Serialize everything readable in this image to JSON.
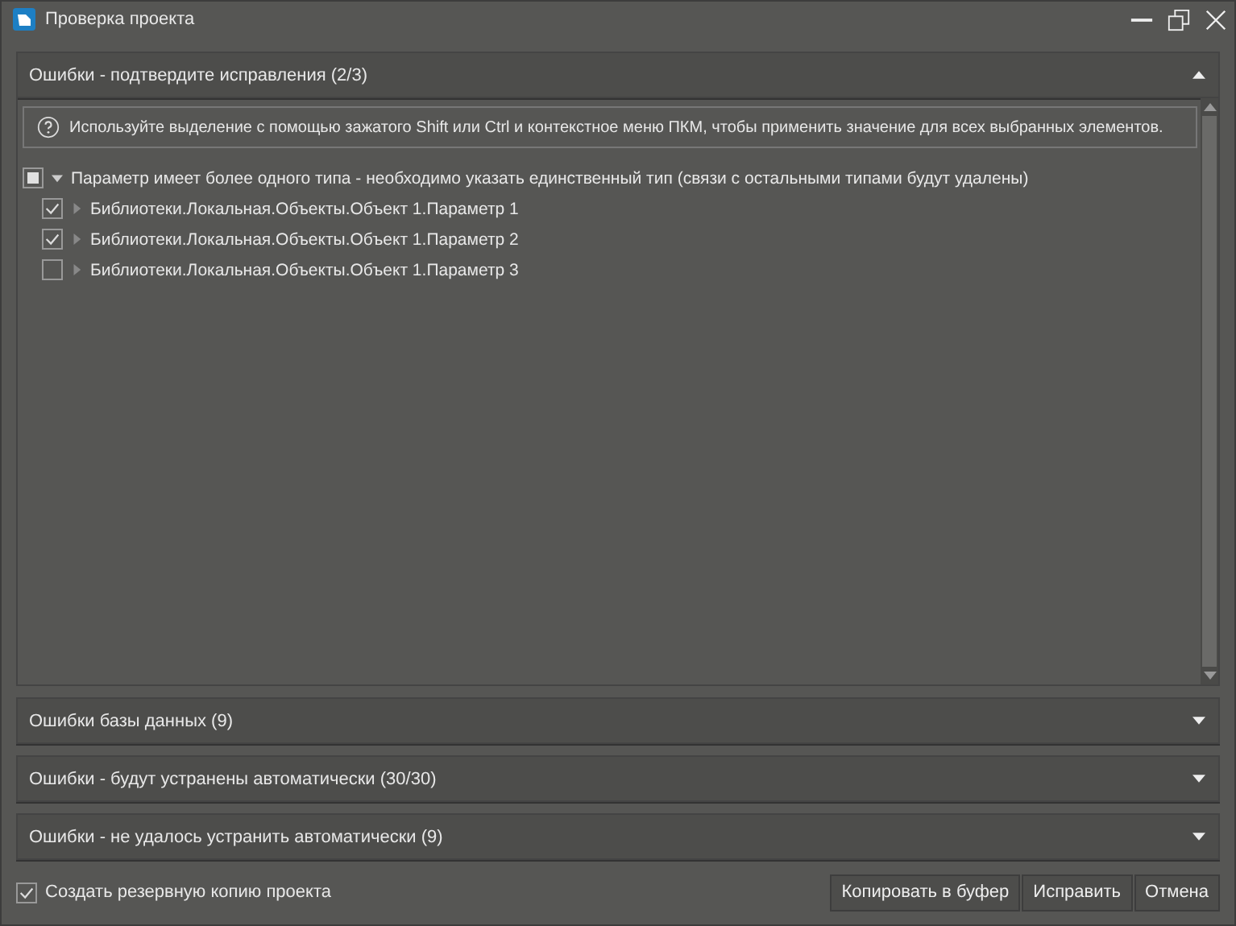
{
  "window": {
    "title": "Проверка проекта"
  },
  "sections": [
    {
      "title": "Ошибки - подтвердите исправления (2/3)",
      "expanded": true,
      "hint": "Используйте выделение с помощью зажатого Shift или Ctrl и контекстное меню ПКМ, чтобы применить значение для всех выбранных элементов.",
      "groups": [
        {
          "label": "Параметр имеет более одного типа - необходимо указать единственный тип (связи с остальными типами будут удалены)",
          "indeterminate": true,
          "expanded": true,
          "children": [
            {
              "label": "Библиотеки.Локальная.Объекты.Объект 1.Параметр 1",
              "checked": true,
              "expanded": false
            },
            {
              "label": "Библиотеки.Локальная.Объекты.Объект 1.Параметр 2",
              "checked": true,
              "expanded": false
            },
            {
              "label": "Библиотеки.Локальная.Объекты.Объект 1.Параметр 3",
              "checked": false,
              "expanded": false
            }
          ]
        }
      ]
    },
    {
      "title": "Ошибки базы данных (9)",
      "expanded": false
    },
    {
      "title": "Ошибки - будут устранены автоматически (30/30)",
      "expanded": false
    },
    {
      "title": "Ошибки - не удалось устранить автоматически (9)",
      "expanded": false
    }
  ],
  "backup": {
    "label": "Создать резервную копию проекта",
    "checked": true
  },
  "buttons": [
    "Копировать в буфер",
    "Исправить",
    "Отмена"
  ]
}
